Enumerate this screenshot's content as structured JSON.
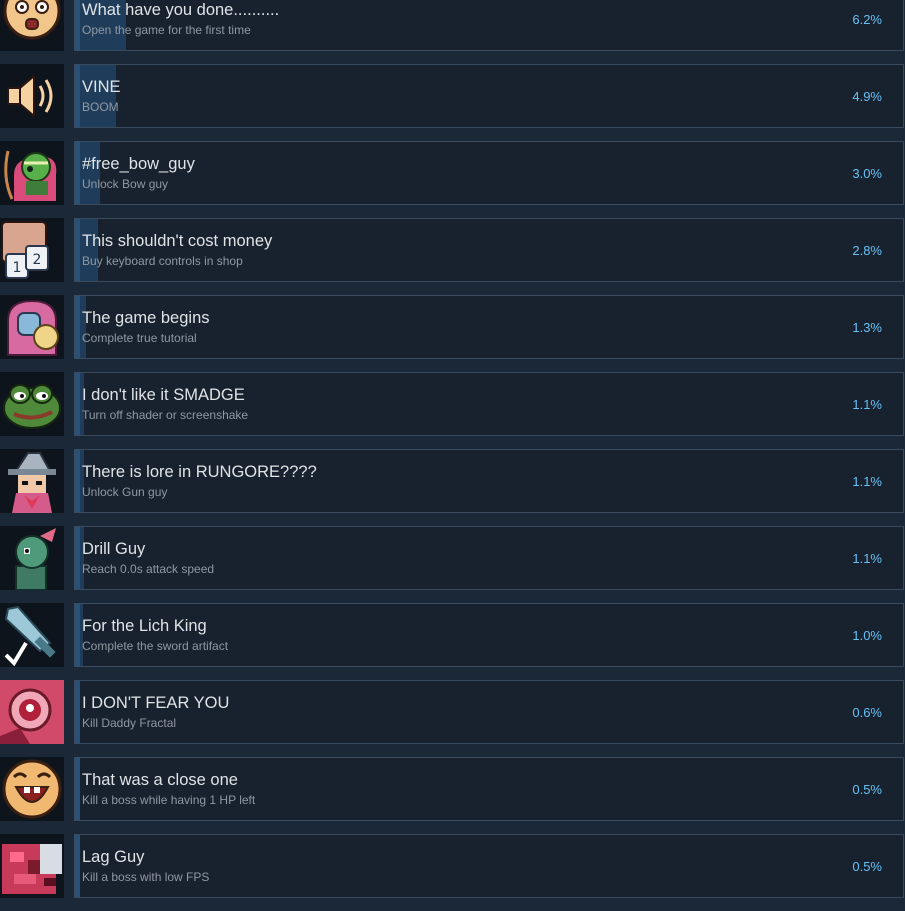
{
  "achievements": [
    {
      "title": "What have you done..........",
      "description": "Open the game for the first time",
      "percent": "6.2%",
      "percent_value": 6.2,
      "icon": "surprised-face-icon"
    },
    {
      "title": "VINE",
      "description": "BOOM",
      "percent": "4.9%",
      "percent_value": 4.9,
      "icon": "speaker-icon"
    },
    {
      "title": "#free_bow_guy",
      "description": "Unlock Bow guy",
      "percent": "3.0%",
      "percent_value": 3.0,
      "icon": "bow-guy-icon"
    },
    {
      "title": "This shouldn't cost money",
      "description": "Buy keyboard controls in shop",
      "percent": "2.8%",
      "percent_value": 2.8,
      "icon": "keyboard-keys-icon"
    },
    {
      "title": "The game begins",
      "description": "Complete true tutorial",
      "percent": "1.3%",
      "percent_value": 1.3,
      "icon": "helmet-guy-icon"
    },
    {
      "title": "I don't like it SMADGE",
      "description": "Turn off shader or screenshake",
      "percent": "1.1%",
      "percent_value": 1.1,
      "icon": "frog-icon"
    },
    {
      "title": "There is lore in RUNGORE????",
      "description": "Unlock Gun guy",
      "percent": "1.1%",
      "percent_value": 1.1,
      "icon": "gun-guy-icon"
    },
    {
      "title": "Drill Guy",
      "description": "Reach 0.0s attack speed",
      "percent": "1.1%",
      "percent_value": 1.1,
      "icon": "drill-guy-icon"
    },
    {
      "title": "For the Lich King",
      "description": "Complete the sword artifact",
      "percent": "1.0%",
      "percent_value": 1.0,
      "icon": "sword-icon"
    },
    {
      "title": "I DON'T FEAR YOU",
      "description": "Kill Daddy Fractal",
      "percent": "0.6%",
      "percent_value": 0.6,
      "icon": "eye-monster-icon"
    },
    {
      "title": "That was a close one",
      "description": "Kill a boss while having 1 HP left",
      "percent": "0.5%",
      "percent_value": 0.5,
      "icon": "laughing-face-icon"
    },
    {
      "title": "Lag Guy",
      "description": "Kill a boss with low FPS",
      "percent": "0.5%",
      "percent_value": 0.5,
      "icon": "glitch-icon"
    }
  ]
}
